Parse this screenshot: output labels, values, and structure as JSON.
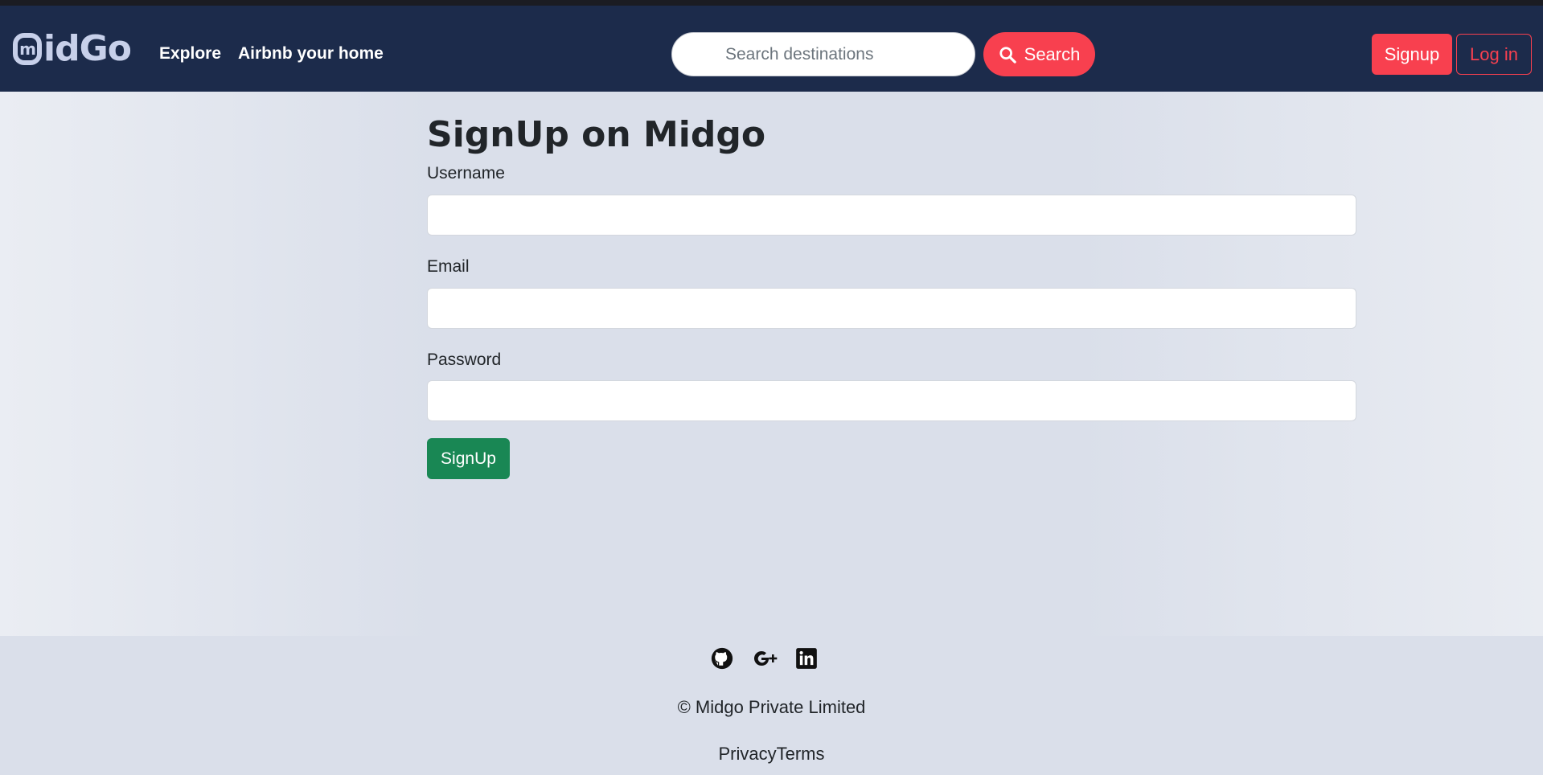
{
  "brand": {
    "name": "idGo",
    "colors": {
      "nav_bg": "#1c2b4b",
      "accent": "#f8404f",
      "success": "#198754"
    }
  },
  "nav": {
    "links": [
      "Explore",
      "Airbnb your home"
    ],
    "search": {
      "placeholder": "Search destinations",
      "button_label": "Search"
    },
    "signup_label": "Signup",
    "login_label": "Log in"
  },
  "form": {
    "title": "SignUp on Midgo",
    "fields": [
      {
        "label": "Username",
        "value": ""
      },
      {
        "label": "Email",
        "value": ""
      },
      {
        "label": "Password",
        "value": ""
      }
    ],
    "submit_label": "SignUp"
  },
  "footer": {
    "social_icons": [
      "github-icon",
      "google-plus-icon",
      "linkedin-icon"
    ],
    "copyright": "© Midgo Private Limited",
    "links": [
      "Privacy",
      "Terms"
    ]
  }
}
